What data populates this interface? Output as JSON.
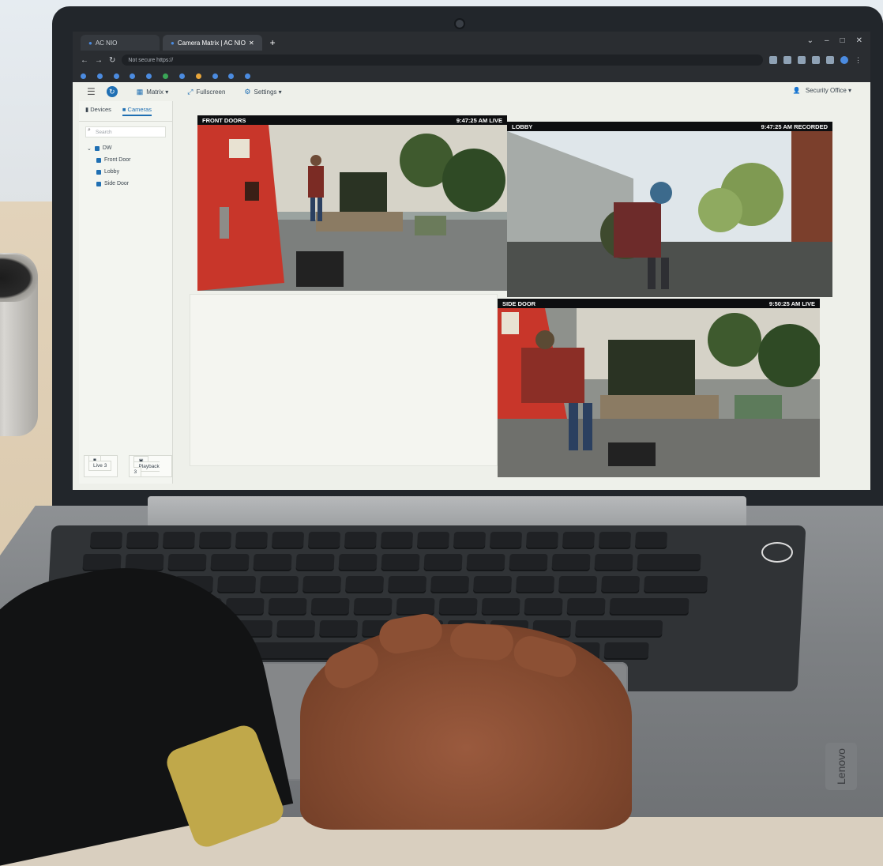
{
  "browser": {
    "tabs": [
      {
        "label": "AC NIO",
        "active": false
      },
      {
        "label": "Camera Matrix | AC NIO",
        "active": true
      }
    ],
    "new_tab": "+",
    "url": "Not secure   https://",
    "window_controls": [
      "⌄",
      "–",
      "□",
      "✕"
    ]
  },
  "app": {
    "toolbar": {
      "menu_icon": "hamburger-icon",
      "matrix_label": "Matrix ▾",
      "fullscreen_label": "Fullscreen",
      "settings_label": "Settings ▾",
      "site_label": "Security Office ▾"
    },
    "sidebar": {
      "tabs": [
        "Devices",
        "Cameras"
      ],
      "active_tab": "Cameras",
      "search_placeholder": "Search",
      "tree": [
        {
          "label": "DW",
          "level": 0
        },
        {
          "label": "Front Door",
          "level": 1
        },
        {
          "label": "Lobby",
          "level": 1
        },
        {
          "label": "Side Door",
          "level": 1
        }
      ],
      "footer": [
        "Live 3",
        "Playback 3"
      ]
    },
    "cameras": [
      {
        "name": "FRONT DOORS",
        "status": "9:47:25 AM LIVE"
      },
      {
        "name": "LOBBY",
        "status": "9:47:25 AM RECORDED"
      },
      {
        "name": "SIDE DOOR",
        "status": "9:50:25 AM LIVE"
      }
    ]
  },
  "laptop": {
    "brand": "Lenovo"
  },
  "colors": {
    "accent": "#1f6fb3",
    "door_red": "#c8362a",
    "camera_bar": "#0d0e10"
  }
}
